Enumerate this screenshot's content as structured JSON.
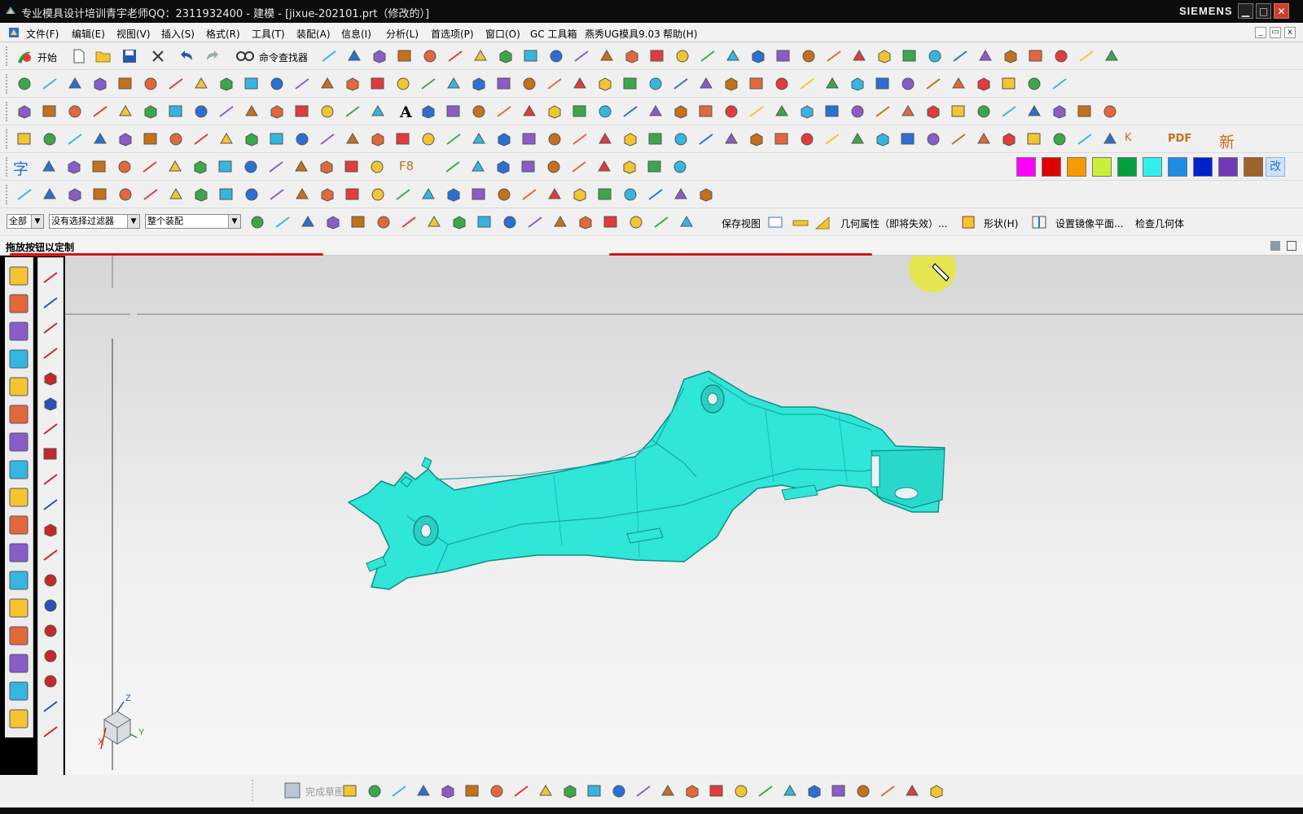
{
  "window": {
    "title": "专业模具设计培训青宇老师QQ：2311932400 - 建模 - [jixue-202101.prt（修改的）]",
    "brand": "SIEMENS",
    "minimize": "▁",
    "maximize": "□",
    "close": "✕"
  },
  "menu": {
    "items": [
      "文件(F)",
      "编辑(E)",
      "视图(V)",
      "插入(S)",
      "格式(R)",
      "工具(T)",
      "装配(A)",
      "信息(I)",
      "分析(L)",
      "首选项(P)",
      "窗口(O)",
      "GC 工具箱",
      "燕秀UG模具9.03",
      "帮助(H)"
    ]
  },
  "toolbar": {
    "start_label": "开始",
    "command_finder": "命令查找器",
    "pdf_label": "PDF",
    "new_char": "新",
    "font_char": "字",
    "f8_label": "F8",
    "k_label": "K",
    "a_label": "A",
    "gai_char": "改"
  },
  "colors": {
    "swatches": [
      "#ff00ff",
      "#dd0000",
      "#f59a00",
      "#c8f03a",
      "#00a040",
      "#33eeee",
      "#1b8fe6",
      "#0022cc",
      "#6f3ab8",
      "#a0622a"
    ],
    "model": "#2fe6d8",
    "accent_red": "#d01818"
  },
  "selection_bar": {
    "filter_all": "全部",
    "no_filter": "没有选择过滤器",
    "assembly": "整个装配",
    "save_view": "保存视图",
    "geom_props": "几何属性（即将失效）...",
    "shape": "形状(H)",
    "mirror_plane": "设置镜像平面...",
    "check_geometry": "检查几何体"
  },
  "cue_line": {
    "text": "拖放按钮以定制"
  },
  "triad": {
    "x": "X",
    "y": "Y",
    "z": "Z"
  },
  "bottom_toolbar": {
    "finish_sketch": "完成草图"
  }
}
